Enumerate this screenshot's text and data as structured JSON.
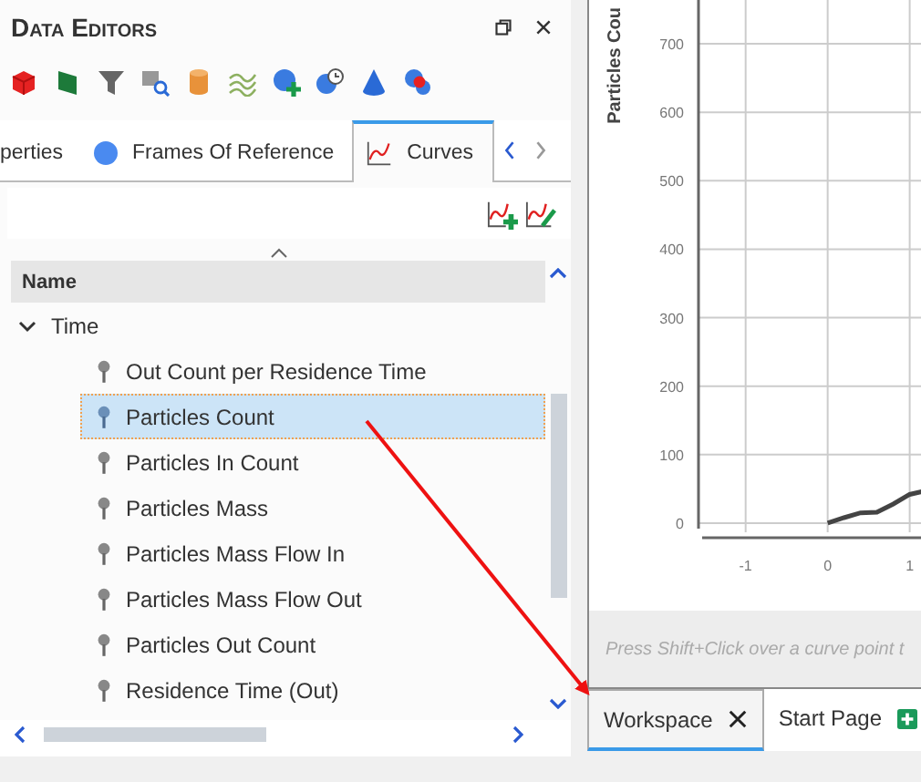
{
  "panel": {
    "title": "Data Editors"
  },
  "tabs": [
    {
      "label": "perties",
      "selected": false,
      "kind": "plain"
    },
    {
      "label": "Frames Of Reference",
      "selected": false,
      "kind": "frames"
    },
    {
      "label": "Curves",
      "selected": true,
      "kind": "curves"
    }
  ],
  "tree": {
    "column": "Name",
    "items": [
      {
        "label": "Time",
        "expanded": true,
        "children": [
          {
            "label": "Out Count per Residence Time",
            "selected": false
          },
          {
            "label": "Particles Count",
            "selected": true
          },
          {
            "label": "Particles In Count",
            "selected": false
          },
          {
            "label": "Particles Mass",
            "selected": false
          },
          {
            "label": "Particles Mass Flow In",
            "selected": false
          },
          {
            "label": "Particles Mass Flow Out",
            "selected": false
          },
          {
            "label": "Particles Out Count",
            "selected": false
          },
          {
            "label": "Residence Time (Out)",
            "selected": false
          }
        ]
      }
    ]
  },
  "chart": {
    "chart_data": {
      "type": "line",
      "ylabel": "Particles Cou",
      "x": [
        0,
        0.2,
        0.4,
        0.6,
        0.8,
        1,
        1.15
      ],
      "series": [
        {
          "color": "#444444",
          "values": [
            0,
            8,
            15,
            16,
            28,
            42,
            46
          ]
        }
      ],
      "yticks": [
        0,
        100,
        200,
        300,
        400,
        500,
        600,
        700
      ],
      "xticks": [
        -1,
        0,
        1
      ],
      "xlim": [
        -1.53,
        1.16
      ],
      "ylim": [
        -8,
        764
      ],
      "grid": true
    },
    "hint": "Press Shift+Click over a curve point t"
  },
  "document_tabs": [
    {
      "label": "Workspace",
      "selected": true,
      "closable": true
    },
    {
      "label": "Start Page",
      "selected": false,
      "closable": false
    }
  ]
}
